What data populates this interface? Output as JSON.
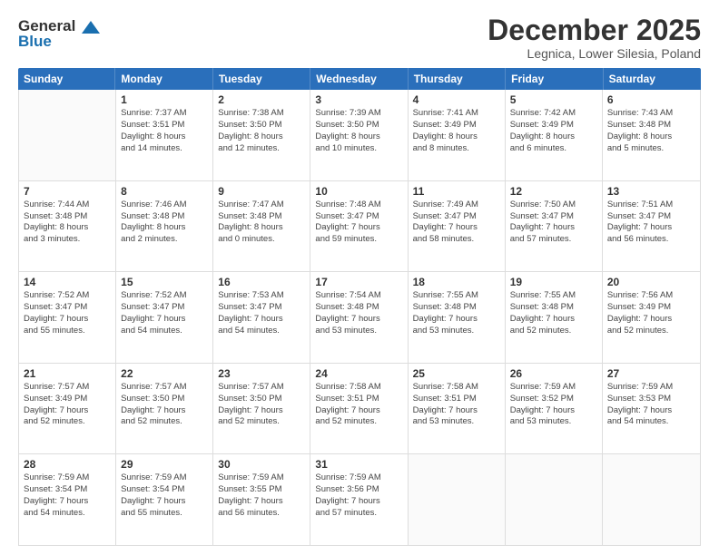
{
  "logo": {
    "line1": "General",
    "line2": "Blue"
  },
  "title": "December 2025",
  "location": "Legnica, Lower Silesia, Poland",
  "weekdays": [
    "Sunday",
    "Monday",
    "Tuesday",
    "Wednesday",
    "Thursday",
    "Friday",
    "Saturday"
  ],
  "weeks": [
    [
      {
        "day": "",
        "info": ""
      },
      {
        "day": "1",
        "info": "Sunrise: 7:37 AM\nSunset: 3:51 PM\nDaylight: 8 hours\nand 14 minutes."
      },
      {
        "day": "2",
        "info": "Sunrise: 7:38 AM\nSunset: 3:50 PM\nDaylight: 8 hours\nand 12 minutes."
      },
      {
        "day": "3",
        "info": "Sunrise: 7:39 AM\nSunset: 3:50 PM\nDaylight: 8 hours\nand 10 minutes."
      },
      {
        "day": "4",
        "info": "Sunrise: 7:41 AM\nSunset: 3:49 PM\nDaylight: 8 hours\nand 8 minutes."
      },
      {
        "day": "5",
        "info": "Sunrise: 7:42 AM\nSunset: 3:49 PM\nDaylight: 8 hours\nand 6 minutes."
      },
      {
        "day": "6",
        "info": "Sunrise: 7:43 AM\nSunset: 3:48 PM\nDaylight: 8 hours\nand 5 minutes."
      }
    ],
    [
      {
        "day": "7",
        "info": "Sunrise: 7:44 AM\nSunset: 3:48 PM\nDaylight: 8 hours\nand 3 minutes."
      },
      {
        "day": "8",
        "info": "Sunrise: 7:46 AM\nSunset: 3:48 PM\nDaylight: 8 hours\nand 2 minutes."
      },
      {
        "day": "9",
        "info": "Sunrise: 7:47 AM\nSunset: 3:48 PM\nDaylight: 8 hours\nand 0 minutes."
      },
      {
        "day": "10",
        "info": "Sunrise: 7:48 AM\nSunset: 3:47 PM\nDaylight: 7 hours\nand 59 minutes."
      },
      {
        "day": "11",
        "info": "Sunrise: 7:49 AM\nSunset: 3:47 PM\nDaylight: 7 hours\nand 58 minutes."
      },
      {
        "day": "12",
        "info": "Sunrise: 7:50 AM\nSunset: 3:47 PM\nDaylight: 7 hours\nand 57 minutes."
      },
      {
        "day": "13",
        "info": "Sunrise: 7:51 AM\nSunset: 3:47 PM\nDaylight: 7 hours\nand 56 minutes."
      }
    ],
    [
      {
        "day": "14",
        "info": "Sunrise: 7:52 AM\nSunset: 3:47 PM\nDaylight: 7 hours\nand 55 minutes."
      },
      {
        "day": "15",
        "info": "Sunrise: 7:52 AM\nSunset: 3:47 PM\nDaylight: 7 hours\nand 54 minutes."
      },
      {
        "day": "16",
        "info": "Sunrise: 7:53 AM\nSunset: 3:47 PM\nDaylight: 7 hours\nand 54 minutes."
      },
      {
        "day": "17",
        "info": "Sunrise: 7:54 AM\nSunset: 3:48 PM\nDaylight: 7 hours\nand 53 minutes."
      },
      {
        "day": "18",
        "info": "Sunrise: 7:55 AM\nSunset: 3:48 PM\nDaylight: 7 hours\nand 53 minutes."
      },
      {
        "day": "19",
        "info": "Sunrise: 7:55 AM\nSunset: 3:48 PM\nDaylight: 7 hours\nand 52 minutes."
      },
      {
        "day": "20",
        "info": "Sunrise: 7:56 AM\nSunset: 3:49 PM\nDaylight: 7 hours\nand 52 minutes."
      }
    ],
    [
      {
        "day": "21",
        "info": "Sunrise: 7:57 AM\nSunset: 3:49 PM\nDaylight: 7 hours\nand 52 minutes."
      },
      {
        "day": "22",
        "info": "Sunrise: 7:57 AM\nSunset: 3:50 PM\nDaylight: 7 hours\nand 52 minutes."
      },
      {
        "day": "23",
        "info": "Sunrise: 7:57 AM\nSunset: 3:50 PM\nDaylight: 7 hours\nand 52 minutes."
      },
      {
        "day": "24",
        "info": "Sunrise: 7:58 AM\nSunset: 3:51 PM\nDaylight: 7 hours\nand 52 minutes."
      },
      {
        "day": "25",
        "info": "Sunrise: 7:58 AM\nSunset: 3:51 PM\nDaylight: 7 hours\nand 53 minutes."
      },
      {
        "day": "26",
        "info": "Sunrise: 7:59 AM\nSunset: 3:52 PM\nDaylight: 7 hours\nand 53 minutes."
      },
      {
        "day": "27",
        "info": "Sunrise: 7:59 AM\nSunset: 3:53 PM\nDaylight: 7 hours\nand 54 minutes."
      }
    ],
    [
      {
        "day": "28",
        "info": "Sunrise: 7:59 AM\nSunset: 3:54 PM\nDaylight: 7 hours\nand 54 minutes."
      },
      {
        "day": "29",
        "info": "Sunrise: 7:59 AM\nSunset: 3:54 PM\nDaylight: 7 hours\nand 55 minutes."
      },
      {
        "day": "30",
        "info": "Sunrise: 7:59 AM\nSunset: 3:55 PM\nDaylight: 7 hours\nand 56 minutes."
      },
      {
        "day": "31",
        "info": "Sunrise: 7:59 AM\nSunset: 3:56 PM\nDaylight: 7 hours\nand 57 minutes."
      },
      {
        "day": "",
        "info": ""
      },
      {
        "day": "",
        "info": ""
      },
      {
        "day": "",
        "info": ""
      }
    ]
  ]
}
